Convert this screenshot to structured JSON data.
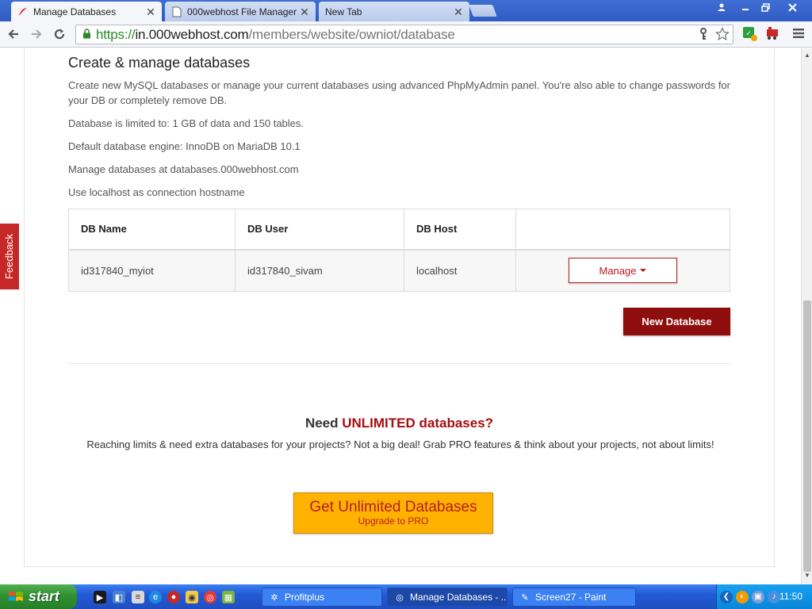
{
  "browser": {
    "tabs": [
      {
        "title": "Manage Databases",
        "active": true
      },
      {
        "title": "000webhost File Manager",
        "active": false
      },
      {
        "title": "New Tab",
        "active": false
      }
    ],
    "url": {
      "scheme": "https://",
      "host": "in.000webhost.com",
      "path": "/members/website/owniot/database"
    }
  },
  "page": {
    "title": "Create & manage databases",
    "intro": "Create new MySQL databases or manage your current databases using advanced PhpMyAdmin panel. You're also able to change passwords for your DB or completely remove DB.",
    "limit": "Database is limited to: 1 GB of data and 150 tables.",
    "engine": "Default database engine: InnoDB on MariaDB 10.1",
    "manage_at": "Manage databases at databases.000webhost.com",
    "hostname_note": "Use localhost as connection hostname",
    "table": {
      "headers": [
        "DB Name",
        "DB User",
        "DB Host",
        ""
      ],
      "rows": [
        {
          "name": "id317840_myiot",
          "user": "id317840_sivam",
          "host": "localhost",
          "action": "Manage"
        }
      ]
    },
    "new_db_button": "New Database",
    "upsell": {
      "title_prefix": "Need ",
      "title_highlight": "UNLIMITED databases?",
      "text": "Reaching limits & need extra databases for your projects? Not a big deal! Grab PRO features & think about your projects, not about limits!",
      "cta_main": "Get Unlimited Databases",
      "cta_sub": "Upgrade to PRO"
    },
    "feedback_label": "Feedback"
  },
  "taskbar": {
    "start_label": "start",
    "items": [
      {
        "label": "Profitplus",
        "active": false
      },
      {
        "label": "Manage Databases - ...",
        "active": true
      },
      {
        "label": "Screen27 - Paint",
        "active": false
      }
    ],
    "clock": "11:50"
  },
  "colors": {
    "brand_red": "#b71c1c",
    "button_dark_red": "#8e0e0e",
    "cta_yellow": "#ffb300"
  }
}
